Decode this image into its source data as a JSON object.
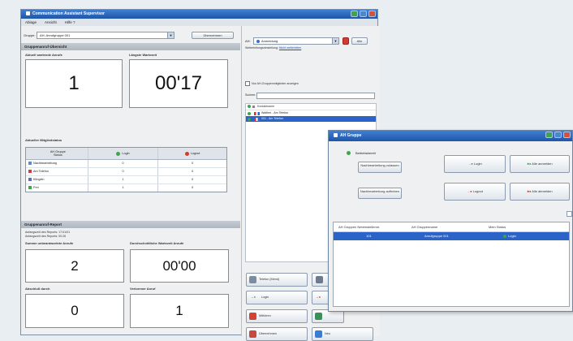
{
  "main_window": {
    "title": "Communication Assistant Supervisor",
    "menu": [
      "Ablage",
      "Ansicht",
      "Hilfe ?"
    ],
    "group_select_label": "Gruppe:",
    "group_select_value": "AH: Anrufgruppe 001",
    "group_select_button": "Übernehmen",
    "overview_section": "Gruppenanruf-Übersicht",
    "waiting_calls_label": "Aktuell wartende Anrufe",
    "waiting_calls_value": "1",
    "longest_wait_label": "Längste Wartezeit",
    "longest_wait_value": "00'17",
    "member_status_label": "Aktueller Mitgliedstatus",
    "member_table": {
      "col_status": "Status",
      "col_group": "AH Gruppe",
      "col_login": "Login",
      "col_logout": "Logout",
      "rows": [
        {
          "label": "Nachbearbeitung",
          "login": "0",
          "logout": "0",
          "color": "#5b8cc9"
        },
        {
          "label": "Am Telefon",
          "login": "0",
          "logout": "0",
          "color": "#c94040"
        },
        {
          "label": "Klingeln",
          "login": "1",
          "logout": "0",
          "color": "#5b6fb3"
        },
        {
          "label": "Frei",
          "login": "1",
          "logout": "0",
          "color": "#3da64a"
        }
      ]
    },
    "report_section": "Gruppenanruf-Report",
    "report_start_label": "Anfangszeit des Reports:",
    "report_start_value": "17:01/01",
    "report_duration_label": "Anfangszeit des Reports:",
    "report_duration_value": "00:26",
    "answered_label": "Summe unbeantwortete Anrufe",
    "answered_value": "2",
    "avg_wait_label": "Durchschnittliche Wartezeit Anrufe",
    "avg_wait_value": "00'00",
    "accepted_label": "Abschluß durch",
    "accepted_value": "0",
    "lost_label": "Verlorener Anruf",
    "lost_value": "1"
  },
  "right_panel": {
    "filter_prefix": "AH:",
    "filter_value": "Anmeldung",
    "filter_button": "Alle",
    "sub_label": "Weiterleitungseinstellung:",
    "sub_link": "Nicht weiterleiten",
    "checkbox_label": "Nur AH-Gruppenmitglieder anzeigen",
    "search_label": "Suchen:",
    "tree_header": "Kontaktname",
    "tree_rows": [
      {
        "name": "Walther - Am Telefon",
        "selected": false
      },
      {
        "name": "001 - Am Telefon",
        "selected": true
      }
    ],
    "buttons": {
      "phone_menu": "Telefon (Menü)",
      "login": "Login",
      "logout": "Logout",
      "listen": "Mithören",
      "take_over": "Übernehmen",
      "new": "Neu"
    }
  },
  "popup": {
    "title": "AH Gruppe",
    "status_label": "Betriebsbereit",
    "wrapup_enable": "Nachbearbeitung zulassen",
    "wrapup_disable": "Nachbearbeitung aufheben",
    "login_button": "Login",
    "logout_button": "Logout",
    "all_login_button": "Alle anmelden",
    "all_logout_button": "Alle abmelden",
    "table_headers": [
      "AH Gruppen Nebenstellennr.",
      "AH Gruppenname",
      "Mein Status"
    ],
    "table_rows": [
      {
        "ext": "101",
        "name": "Anrufgruppe 001",
        "status": "Login"
      }
    ]
  }
}
